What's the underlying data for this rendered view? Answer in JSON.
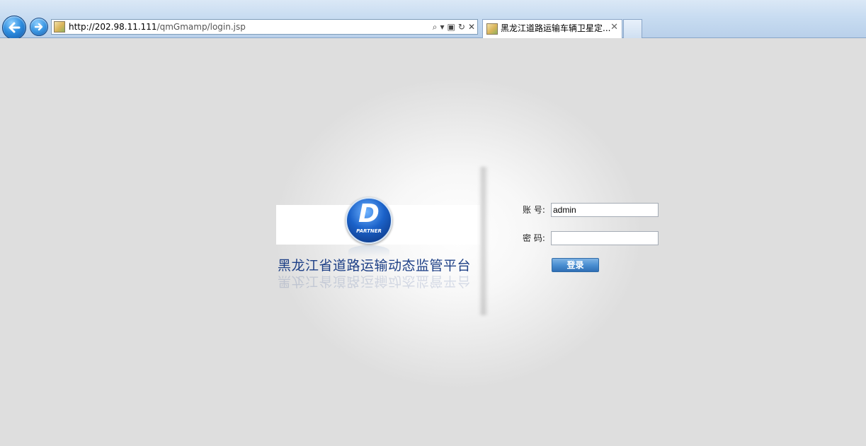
{
  "browser": {
    "url_host": "http://202.98.11.111",
    "url_path": "/qmGmamp/login.jsp",
    "tab_title": "黑龙江道路运输车辆卫星定...",
    "tab_close": "✕",
    "tools": {
      "search": "⌕",
      "dropdown": "▾",
      "compat": "▣",
      "refresh": "↻",
      "stop": "✕"
    }
  },
  "logo": {
    "letter": "D",
    "sub": "PARTNER"
  },
  "site_title": "黑龙江省道路运输动态监管平台",
  "login_form": {
    "account_label": "账 号:",
    "account_value": "admin",
    "password_label": "密 码:",
    "password_value": "",
    "submit_label": "登录"
  },
  "colors": {
    "accent": "#1d3f86",
    "button": "#4b8fd2",
    "page_bg": "#dedede"
  }
}
